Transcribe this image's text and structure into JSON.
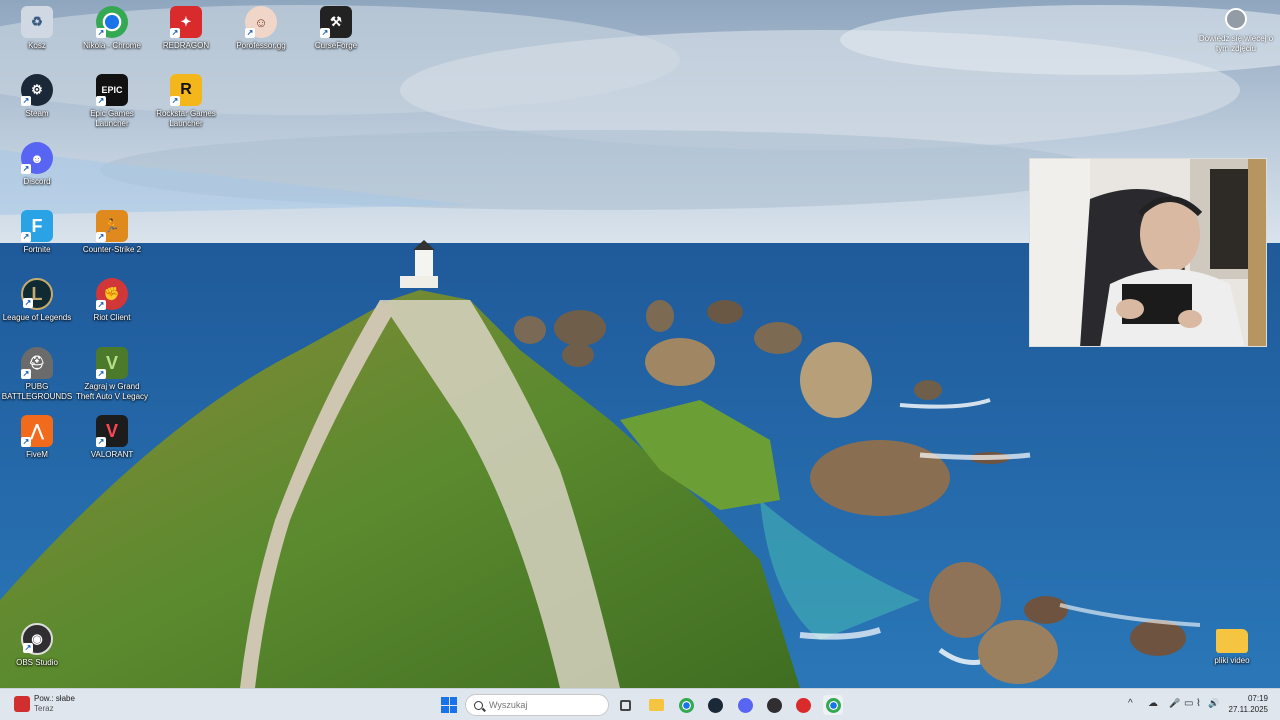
{
  "desktop": {
    "icons": [
      {
        "label": "Kosz",
        "icon": "recycle-bin-icon",
        "color": "#cfd8e3"
      },
      {
        "label": "Nikola - Chrome",
        "icon": "chrome-icon",
        "color": "#34a853"
      },
      {
        "label": "REDRAGON",
        "icon": "redragon-icon",
        "color": "#d92b2b"
      },
      {
        "label": "Porofessor.gg",
        "icon": "porofessor-icon",
        "color": "#f0d6c8"
      },
      {
        "label": "CurseForge",
        "icon": "curseforge-icon",
        "color": "#222222"
      },
      {
        "label": "Steam",
        "icon": "steam-icon",
        "color": "#1b2838"
      },
      {
        "label": "Epic Games Launcher",
        "icon": "epic-games-icon",
        "color": "#111111",
        "glyph": "EPIC"
      },
      {
        "label": "Rockstar Games Launcher",
        "icon": "rockstar-icon",
        "color": "#f3b71c",
        "glyph": "R"
      },
      {
        "label": "Discord",
        "icon": "discord-icon",
        "color": "#5865f2"
      },
      {
        "label": "Fortnite",
        "icon": "fortnite-icon",
        "color": "#2aa3e6",
        "glyph": "F"
      },
      {
        "label": "Counter-Strike 2",
        "icon": "counter-strike-icon",
        "color": "#e08a1e"
      },
      {
        "label": "League of Legends",
        "icon": "league-of-legends-icon",
        "color": "#0f2a33",
        "glyph": "L"
      },
      {
        "label": "Riot Client",
        "icon": "riot-client-icon",
        "color": "#d13639"
      },
      {
        "label": "PUBG BATTLEGROUNDS",
        "icon": "pubg-icon",
        "color": "#6b6b6b"
      },
      {
        "label": "Zagraj w Grand Theft Auto V Legacy",
        "icon": "gta-v-icon",
        "color": "#4a7a2a",
        "glyph": "V"
      },
      {
        "label": "FiveM",
        "icon": "fivem-icon",
        "color": "#f26b1d"
      },
      {
        "label": "VALORANT",
        "icon": "valorant-icon",
        "color": "#1c1c1c",
        "glyph": "V"
      },
      {
        "label": "OBS Studio",
        "icon": "obs-icon",
        "color": "#302e31"
      },
      {
        "label": "pliki video",
        "icon": "folder-icon",
        "color": "#f5c542"
      }
    ],
    "learn_more": "Dowiedz się więcej o tym zdjęciu"
  },
  "taskbar": {
    "notification": {
      "title": "Pow.: słabe",
      "subtitle": "Teraz"
    },
    "search_placeholder": "Wyszukaj",
    "apps": [
      {
        "icon": "task-view-icon",
        "color": "#444444"
      },
      {
        "icon": "file-explorer-icon",
        "color": "#f5c542"
      },
      {
        "icon": "chrome-icon",
        "color": "#34a853"
      },
      {
        "icon": "steam-icon",
        "color": "#1b2838"
      },
      {
        "icon": "discord-icon",
        "color": "#5865f2"
      },
      {
        "icon": "obs-icon",
        "color": "#302e31"
      },
      {
        "icon": "record-icon",
        "color": "#d92b2b"
      },
      {
        "icon": "chrome-icon",
        "color": "#34a853"
      }
    ],
    "tray": {
      "chevron": "^",
      "cloud": "☁",
      "mic": "🎤",
      "display": "▭",
      "wifi": "⌇",
      "volume": "🔊"
    },
    "clock": {
      "time": "07:19",
      "date": "27.11.2025"
    }
  }
}
